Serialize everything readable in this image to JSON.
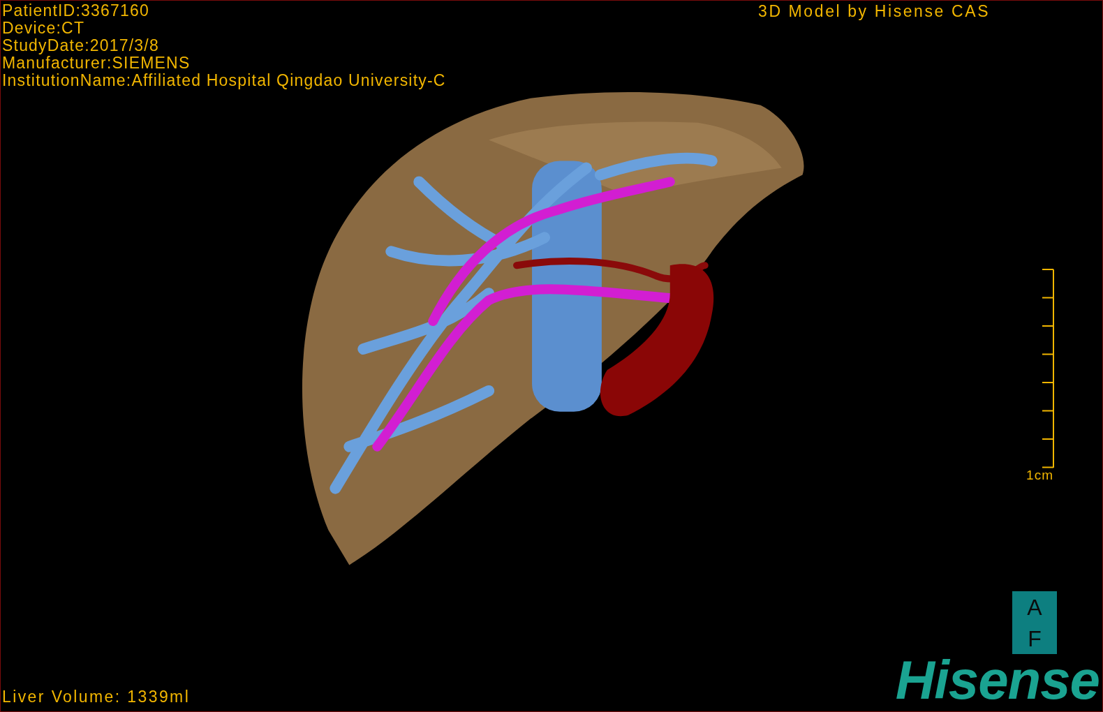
{
  "info": {
    "lines": [
      "PatientID:3367160",
      "Device:CT",
      "StudyDate:2017/3/8",
      "Manufacturer:SIEMENS",
      "InstitutionName:Affiliated Hospital Qingdao University-C"
    ]
  },
  "title": "3D Model by Hisense CAS",
  "scale": {
    "label": "1cm"
  },
  "orientation": {
    "top": "A",
    "bottom": "F"
  },
  "volume": "Liver Volume: 1339ml",
  "logo": "Hisense"
}
